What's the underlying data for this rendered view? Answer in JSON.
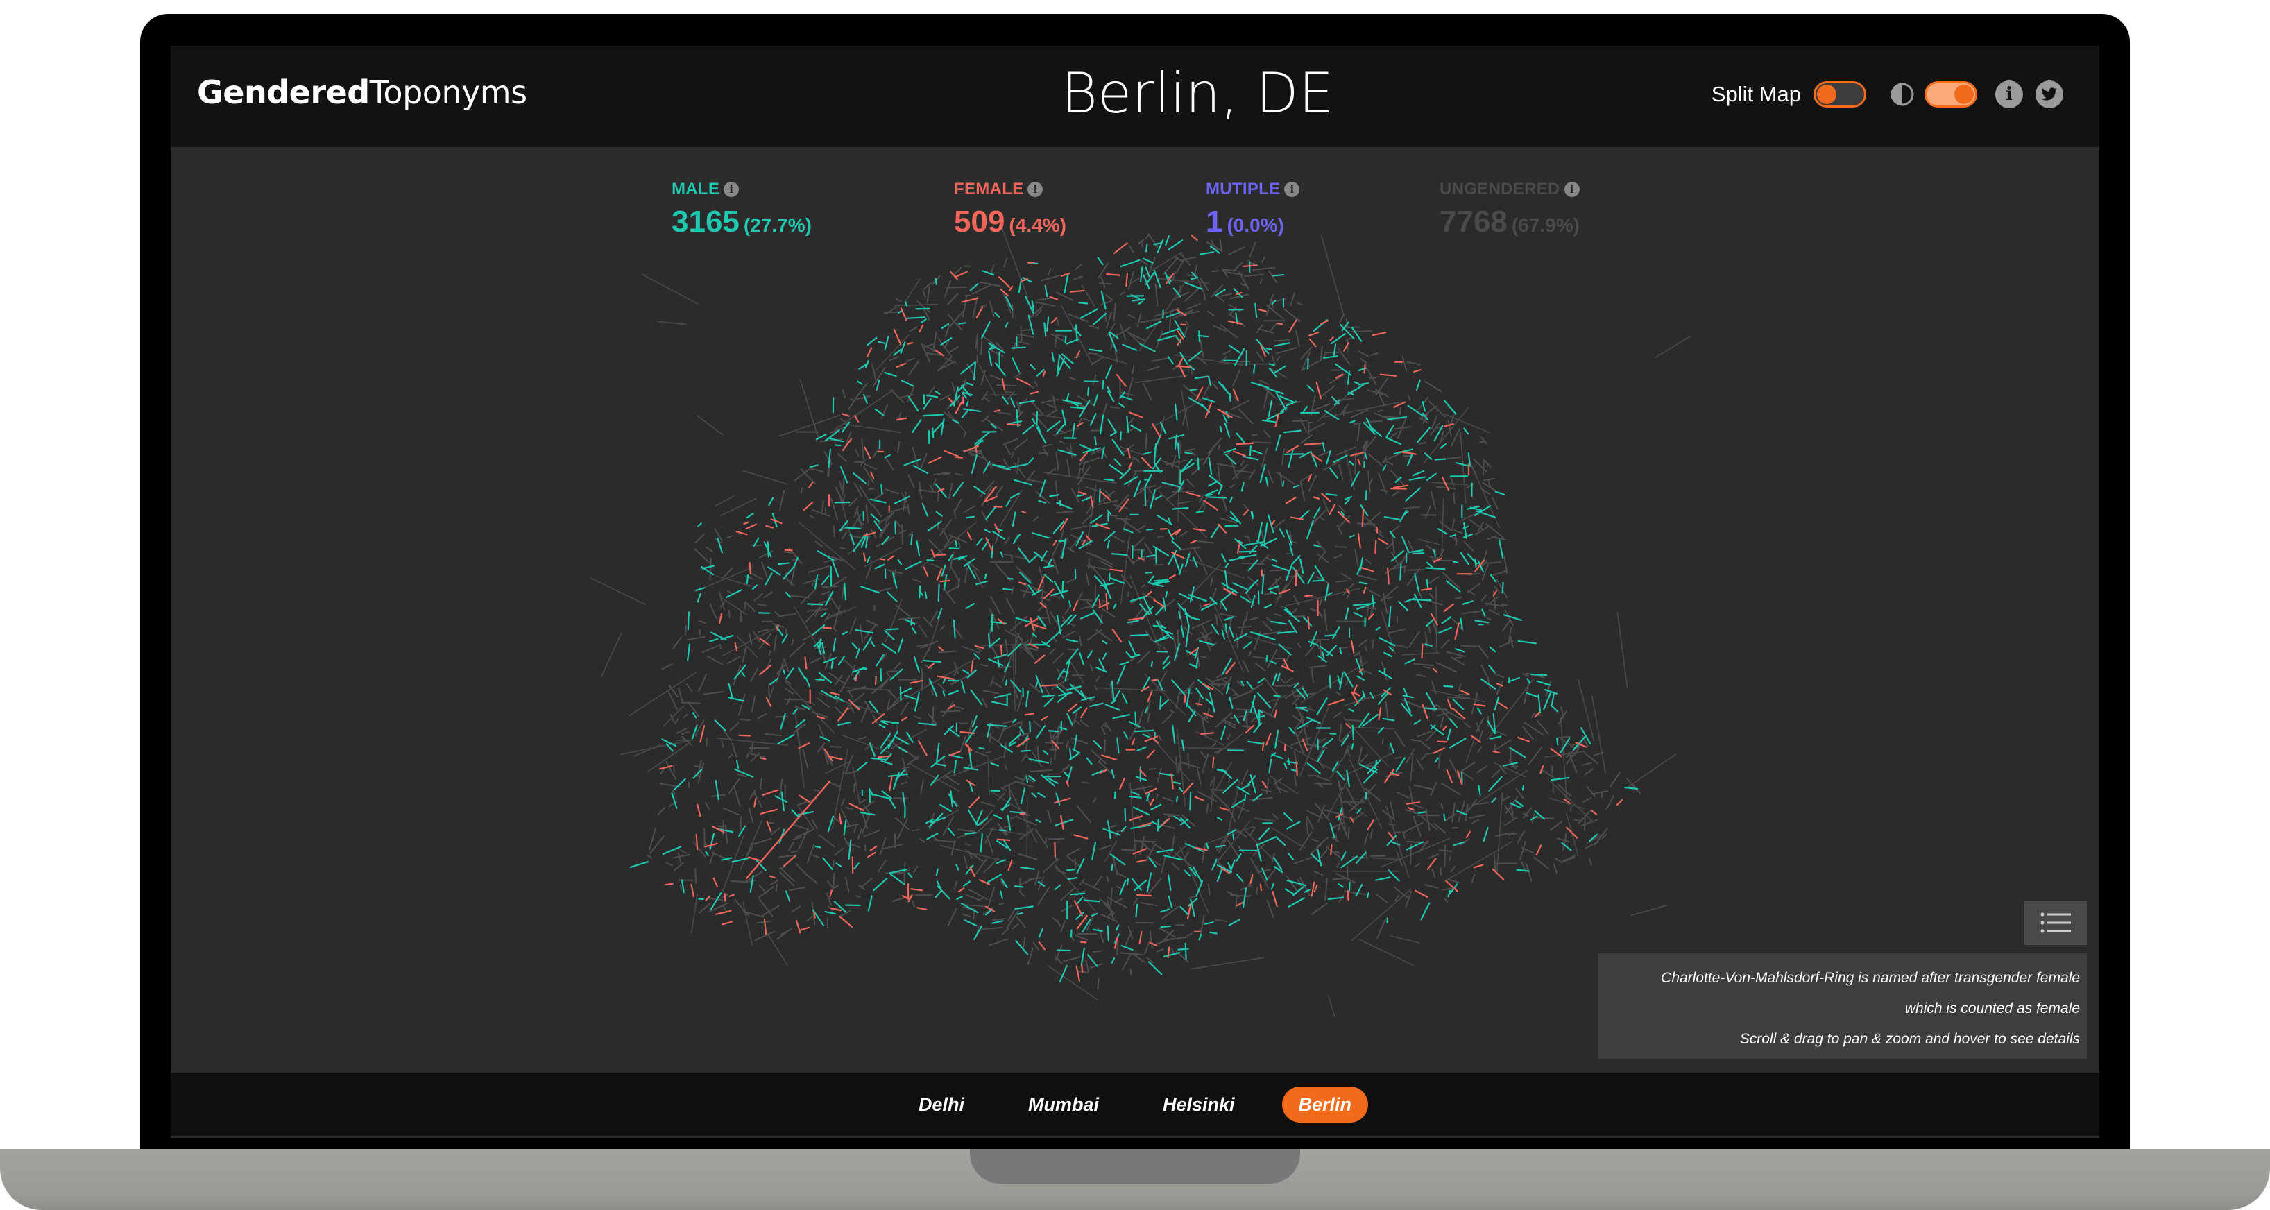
{
  "header": {
    "logo_bold": "Gendered",
    "logo_light": "Toponyms",
    "city_title": "Berlin, DE",
    "split_map_label": "Split Map",
    "info_icon_glyph": "i",
    "icons": [
      "contrast-icon",
      "info-icon",
      "twitter-icon"
    ]
  },
  "stats": [
    {
      "label": "MALE",
      "count": "3165",
      "percent": "(27.7%)",
      "color": "#1fc7b0"
    },
    {
      "label": "FEMALE",
      "count": "509",
      "percent": "(4.4%)",
      "color": "#f0665a"
    },
    {
      "label": "MUTIPLE",
      "count": "1",
      "percent": "(0.0%)",
      "color": "#6c63f0"
    },
    {
      "label": "UNGENDERED",
      "count": "7768",
      "percent": "(67.9%)",
      "color": "#4a4a4a"
    }
  ],
  "note": {
    "line1": "Charlotte-Von-Mahlsdorf-Ring is named after transgender female",
    "line2": "which is counted as female",
    "line3": "Scroll & drag to pan & zoom and hover to see details"
  },
  "cities": [
    {
      "label": "Delhi",
      "active": false
    },
    {
      "label": "Mumbai",
      "active": false
    },
    {
      "label": "Helsinki",
      "active": false
    },
    {
      "label": "Berlin",
      "active": true
    }
  ],
  "colors": {
    "accent": "#f26b1d",
    "male": "#1fc7b0",
    "female": "#f0665a",
    "ungendered": "#4a4a4a",
    "background": "#2b2b2b"
  }
}
